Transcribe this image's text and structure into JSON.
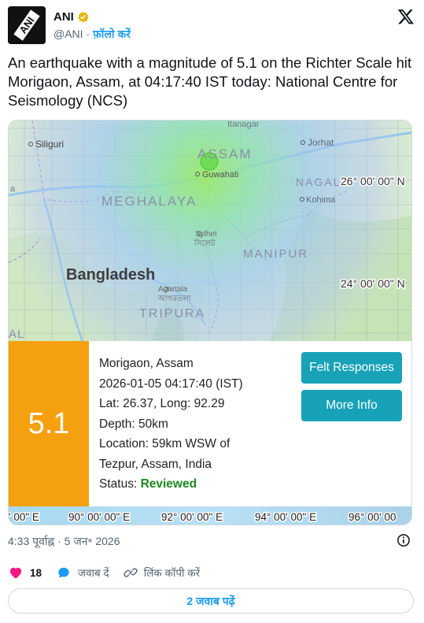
{
  "author": {
    "name": "ANI",
    "handle": "@ANI",
    "separator": " · ",
    "follow_label": "फ़ॉलो करें",
    "avatar_text": "ANI"
  },
  "tweet": {
    "text": "An earthquake with a magnitude of 5.1 on the Richter Scale hit Morigaon, Assam, at 04:17:40 IST today: National Centre for Seismology (NCS)",
    "timestamp": "4:33 पूर्वाह्न · 5 जन॰ 2026"
  },
  "map": {
    "labels": {
      "siliguri": "Siliguri",
      "itanagar": "Itanagar",
      "jorhat": "Jorhat",
      "assam": "ASSAM",
      "guwahati": "Guwahati",
      "nagaland": "NAGALA",
      "kohima": "Kohima",
      "meghalaya": "MEGHALAYA",
      "sylhet": "Sylhet",
      "sylhet_local": "সিলেট",
      "manipur": "MANIPUR",
      "bangladesh": "Bangladesh",
      "agartala": "Agartala",
      "agartala_local": "আগরতলা",
      "tripura": "TRIPURA",
      "bengal": "AL",
      "left_edge": "a",
      "lat_26": "26° 00' 00\" N",
      "lat_24": "24° 00' 00\" N"
    },
    "lon_labels": [
      "' 00\" E",
      "90° 00' 00\" E",
      "92° 00' 00\" E",
      "94° 00' 00\" E",
      "96° 00' 00"
    ]
  },
  "quake": {
    "magnitude": "5.1",
    "place": "Morigaon, Assam",
    "datetime": "2026-01-05 04:17:40 (IST)",
    "latlong": "Lat: 26.37, Long: 92.29",
    "depth": "Depth: 50km",
    "location_line1": "Location: 59km WSW of",
    "location_line2": "Tezpur, Assam, India",
    "status_label": "Status: ",
    "status_value": "Reviewed"
  },
  "buttons": {
    "felt": "Felt Responses",
    "more": "More Info"
  },
  "actions": {
    "likes": "18",
    "reply": "जवाब दें",
    "copy_link": "लिंक कॉपी करें",
    "read_replies": "2 जवाब पढ़ें"
  },
  "colors": {
    "accent": "#1d9bf0",
    "magnitude_box": "#f5a00f",
    "button": "#17a2b8",
    "status_ok": "#188a1d",
    "like": "#f91880"
  },
  "icons": {
    "verified": "verified-badge-icon",
    "x_logo": "x-logo-icon",
    "info": "info-icon",
    "like": "heart-icon",
    "reply": "comment-bubble-icon",
    "copy_link": "link-icon"
  }
}
